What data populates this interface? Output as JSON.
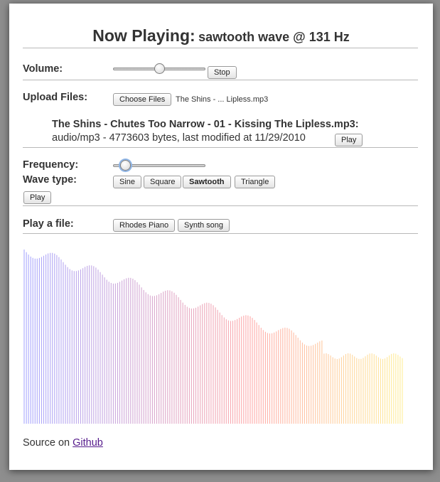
{
  "header": {
    "lead": "Now Playing:",
    "track": "sawtooth wave @ 131 Hz"
  },
  "volume": {
    "label": "Volume:",
    "level": 0.5,
    "stop_label": "Stop"
  },
  "upload": {
    "label": "Upload Files:",
    "choose_label": "Choose Files",
    "chosen_name": "The Shins - ... Lipless.mp3",
    "file_title": "The Shins - Chutes Too Narrow - 01 - Kissing The Lipless.mp3:",
    "file_meta": "audio/mp3 - 4773603 bytes, last modified at 11/29/2010",
    "play_label": "Play"
  },
  "synth": {
    "frequency_label": "Frequency:",
    "frequency_level": 0.13,
    "wave_type_label": "Wave type:",
    "wave_types": [
      "Sine",
      "Square",
      "Sawtooth",
      "Triangle"
    ],
    "selected_wave": "Sawtooth",
    "play_label": "Play"
  },
  "files": {
    "label": "Play a file:",
    "options": [
      "Rhodes Piano",
      "Synth song"
    ]
  },
  "visualizer": {
    "gradient_start": "#a8a8ff",
    "gradient_mid": "#ffaaaa",
    "gradient_end": "#ffee99"
  },
  "footer": {
    "prefix": "Source on",
    "link_label": "Github"
  }
}
